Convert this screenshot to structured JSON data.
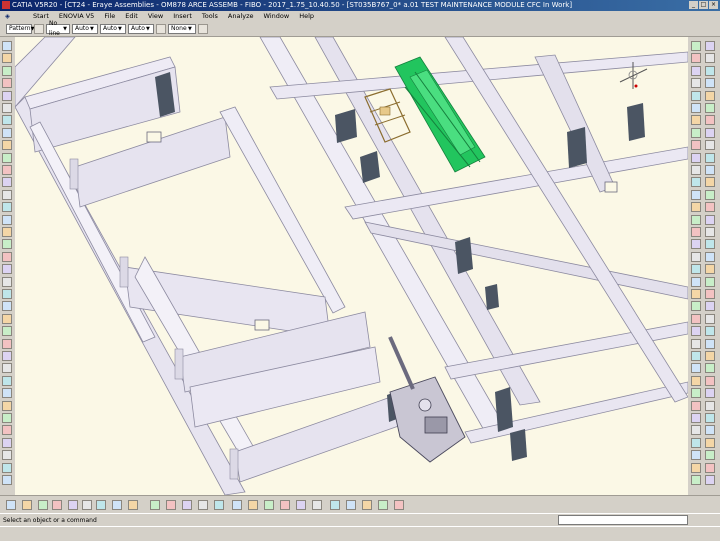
{
  "window": {
    "title": "CATIA V5R20 - [CT24 - Eraye Assemblies - OM878 ARCE ASSEMB - FIBO - 2017_1.75_10.40.50 - [ST035B767_0* a.01 TEST MAINTENANCE MODULE CFC In Work]",
    "controls": [
      "_",
      "□",
      "×"
    ]
  },
  "menu": {
    "items": [
      "Start",
      "ENOVIA V5",
      "File",
      "Edit",
      "View",
      "Insert",
      "Tools",
      "Analyze",
      "Window",
      "Help"
    ]
  },
  "properties_bar": {
    "combos": [
      {
        "value": "Pattern"
      },
      {
        "value": "No line"
      },
      {
        "value": "Auto"
      },
      {
        "value": "Auto"
      },
      {
        "value": "Auto"
      },
      {
        "value": "None"
      }
    ]
  },
  "status": {
    "message": "Select an object or a command"
  },
  "colors": {
    "viewport_bg": "#fbf8e6",
    "wall": "#ece9f4",
    "wall_shadow": "#c9c6d6",
    "door": "#4b5563",
    "equipment": "#22c55e",
    "frame": "#e5e3ee"
  },
  "icons": {
    "left_toolbar": "workbench-tool-icons",
    "right_toolbar": "part-design-tool-icons",
    "bottom_toolbar": "view-tool-icons",
    "compass": "compass-icon"
  }
}
